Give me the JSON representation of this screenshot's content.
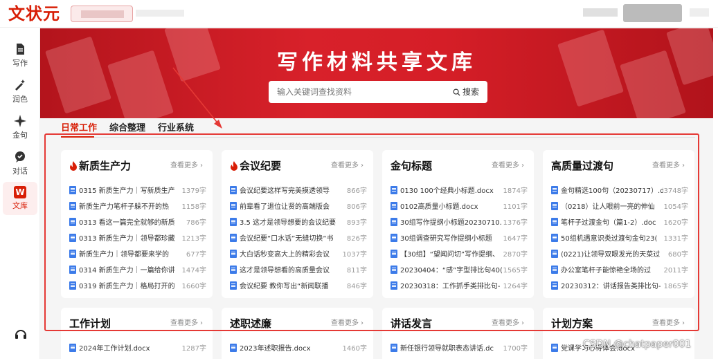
{
  "app": {
    "logo": "文状元"
  },
  "sidebar": {
    "items": [
      {
        "label": "写作",
        "icon": "document-icon"
      },
      {
        "label": "润色",
        "icon": "magic-wand-icon"
      },
      {
        "label": "金句",
        "icon": "sparkle-icon"
      },
      {
        "label": "对话",
        "icon": "chat-icon"
      },
      {
        "label": "文库",
        "icon": "library-icon",
        "active": true,
        "badge": "W"
      }
    ]
  },
  "banner": {
    "title": "写作材料共享文库",
    "search_placeholder": "输入关键词查找资料",
    "search_button": "搜索"
  },
  "tabs": [
    "日常工作",
    "综合整理",
    "行业系统"
  ],
  "more_label": "查看更多",
  "cards": [
    {
      "title": "新质生产力",
      "hot": true,
      "rows": [
        {
          "t": "0315 新质生产力｜写新质生产",
          "c": "1379字"
        },
        {
          "t": "新质生产力笔杆子躲不开的热",
          "c": "1158字"
        },
        {
          "t": "0313 看这一篇完全就够的新质",
          "c": "786字"
        },
        {
          "t": "0313 新质生产力｜领导都珍藏",
          "c": "1213字"
        },
        {
          "t": "新质生产力｜领导都要来学的",
          "c": "677字"
        },
        {
          "t": "0314 新质生产力｜一篇给你讲",
          "c": "1474字"
        },
        {
          "t": "0319 新质生产力｜格局打开的",
          "c": "1660字"
        }
      ]
    },
    {
      "title": "会议纪要",
      "hot": true,
      "rows": [
        {
          "t": "会议纪要这样写完美摸透领导",
          "c": "866字"
        },
        {
          "t": "前辈看了退位让贤的高端版会",
          "c": "806字"
        },
        {
          "t": "3.5 这才是领导想要的会议纪要",
          "c": "893字"
        },
        {
          "t": "会议纪要“口水话”无缝切换“书",
          "c": "826字"
        },
        {
          "t": "大白话秒变高大上的精彩会议",
          "c": "1037字"
        },
        {
          "t": "这才是领导想看的高质量会议",
          "c": "811字"
        },
        {
          "t": "会议纪要 教你写出“新闻联播",
          "c": "846字"
        }
      ]
    },
    {
      "title": "金句标题",
      "hot": false,
      "rows": [
        {
          "t": "0130 100个经典小标题.docx",
          "c": "1874字"
        },
        {
          "t": "0102高质量小标题.docx",
          "c": "1101字"
        },
        {
          "t": "30组写作提纲小标题20230710.",
          "c": "1376字"
        },
        {
          "t": "30组调查研究写作提纲小标题",
          "c": "1647字"
        },
        {
          "t": "【30组】“望闻问切”写作提纲、",
          "c": "2870字"
        },
        {
          "t": "20230404：“感”字型排比句40(",
          "c": "1565字"
        },
        {
          "t": "20230318：工作抓手类排比句-",
          "c": "1264字"
        }
      ]
    },
    {
      "title": "高质量过渡句",
      "hot": false,
      "rows": [
        {
          "t": "金句精选100句（20230717）.d",
          "c": "3748字"
        },
        {
          "t": "（0218）让人眼前一亮的伸仙",
          "c": "1054字"
        },
        {
          "t": "笔杆子过渡金句（篇1-2）.doc",
          "c": "1620字"
        },
        {
          "t": "50组机遇意识类过渡句金句23(",
          "c": "1331字"
        },
        {
          "t": "(0221)让领导双眼发光的天菜过",
          "c": "680字"
        },
        {
          "t": "办公室笔杆子能惊艳全场的过",
          "c": "2011字"
        },
        {
          "t": "20230312：讲话报告类排比句-",
          "c": "1865字"
        }
      ]
    },
    {
      "title": "工作计划",
      "hot": false,
      "rows": [
        {
          "t": "2024年工作计划.docx",
          "c": "1287字"
        }
      ]
    },
    {
      "title": "述职述廉",
      "hot": false,
      "rows": [
        {
          "t": "2023年述职报告.docx",
          "c": "1460字"
        }
      ]
    },
    {
      "title": "讲话发言",
      "hot": false,
      "rows": [
        {
          "t": "新任银行领导就职表态讲话.dc",
          "c": "1700字"
        }
      ]
    },
    {
      "title": "计划方案",
      "hot": false,
      "rows": [
        {
          "t": "党课学习心得体会.docx",
          "c": ""
        }
      ]
    }
  ],
  "watermark": "CSDN @chatpaper001",
  "colors": {
    "brand": "#d81e06",
    "annotation": "#e53935",
    "doc_icon": "#3c7be9"
  }
}
